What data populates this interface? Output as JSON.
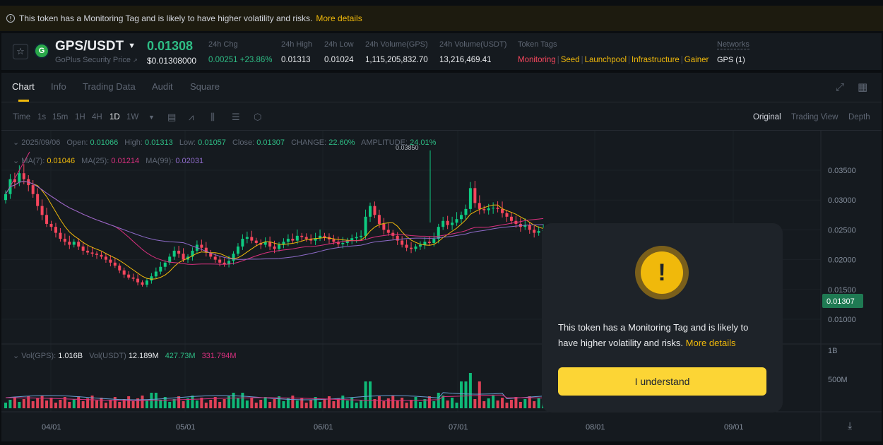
{
  "banner": {
    "text": "This token has a Monitoring Tag and is likely to have higher volatility and risks.",
    "more": "More details"
  },
  "header": {
    "pair": "GPS/USDT",
    "pair_sub": "GoPlus Security Price",
    "price": "0.01308",
    "price_usd": "$0.01308000",
    "stats": [
      {
        "label": "24h Chg",
        "value": "0.00251 +23.86%"
      },
      {
        "label": "24h High",
        "value": "0.01313"
      },
      {
        "label": "24h Low",
        "value": "0.01024"
      },
      {
        "label": "24h Volume(GPS)",
        "value": "1,115,205,832.70"
      },
      {
        "label": "24h Volume(USDT)",
        "value": "13,216,469.41"
      }
    ],
    "token_tags_label": "Token Tags",
    "tags": [
      "Monitoring",
      "Seed",
      "Launchpool",
      "Infrastructure",
      "Gainer"
    ],
    "networks_label": "Networks",
    "networks_value": "GPS (1)"
  },
  "tabs": [
    "Chart",
    "Info",
    "Trading Data",
    "Audit",
    "Square"
  ],
  "timeframes": [
    "Time",
    "1s",
    "15m",
    "1H",
    "4H",
    "1D",
    "1W"
  ],
  "views": [
    "Original",
    "Trading View",
    "Depth"
  ],
  "ohlc": {
    "date": "2025/09/06",
    "open_label": "Open:",
    "open": "0.01066",
    "high_label": "High:",
    "high": "0.01313",
    "low_label": "Low:",
    "low": "0.01057",
    "close_label": "Close:",
    "close": "0.01307",
    "change_label": "CHANGE:",
    "change": "22.60%",
    "amplitude_label": "AMPLITUDE:",
    "amplitude": "24.01%"
  },
  "ma": {
    "ma7_label": "MA(7):",
    "ma7": "0.01046",
    "ma25_label": "MA(25):",
    "ma25": "0.01214",
    "ma99_label": "MA(99):",
    "ma99": "0.02031"
  },
  "vol": {
    "gps_label": "Vol(GPS):",
    "gps": "1.016B",
    "usdt_label": "Vol(USDT)",
    "usdt": "12.189M",
    "v2": "427.73M",
    "v3": "331.794M"
  },
  "chart_data": {
    "type": "candlestick",
    "price_axis_ticks": [
      "0.03500",
      "0.03000",
      "0.02500",
      "0.02000",
      "0.01500",
      "0.01000"
    ],
    "volume_axis_ticks": [
      "1B",
      "500M"
    ],
    "x_ticks": [
      "04/01",
      "05/01",
      "06/01",
      "07/01",
      "08/01",
      "09/01"
    ],
    "last_price_tag": "0.01307",
    "max_marker": "0.03850",
    "colors": {
      "up": "#0ecb81",
      "down": "#f6465d",
      "ma7": "#f0b90b",
      "ma25": "#d9307f",
      "ma99": "#8e6bc9"
    }
  },
  "modal": {
    "text": "This token has a Monitoring Tag and is likely to have higher volatility and risks.",
    "more": "More details",
    "button": "I understand"
  }
}
